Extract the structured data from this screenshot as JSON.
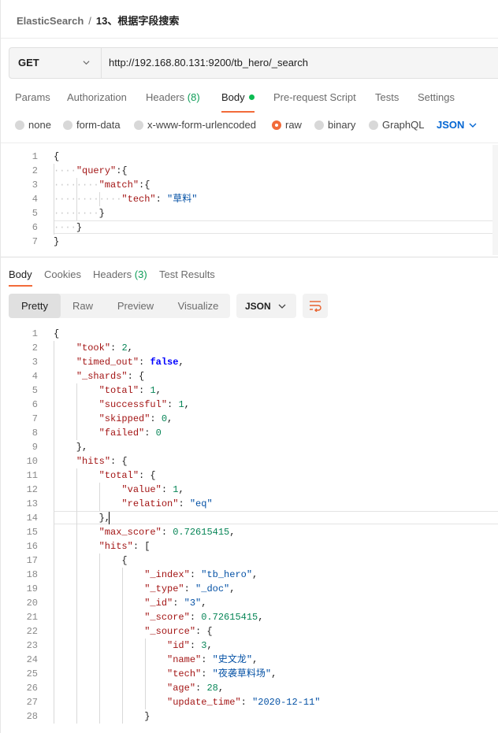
{
  "breadcrumb": {
    "parent": "ElasticSearch",
    "separator": "/",
    "current": "13、根据字段搜索"
  },
  "request": {
    "method": "GET",
    "url": "http://192.168.80.131:9200/tb_hero/_search",
    "tabs": [
      {
        "label": "Params"
      },
      {
        "label": "Authorization"
      },
      {
        "label": "Headers",
        "count": "(8)"
      },
      {
        "label": "Body",
        "active": true
      },
      {
        "label": "Pre-request Script"
      },
      {
        "label": "Tests"
      },
      {
        "label": "Settings"
      }
    ],
    "body_types": [
      "none",
      "form-data",
      "x-www-form-urlencoded",
      "raw",
      "binary",
      "GraphQL"
    ],
    "body_type_selected": "raw",
    "language": "JSON"
  },
  "request_lines": [
    [
      "{"
    ],
    [
      "····",
      "k:\"query\"",
      ":{"
    ],
    [
      "········",
      "k:\"match\"",
      ":{"
    ],
    [
      "············",
      "k:\"tech\"",
      ": ",
      "s:\"草料\""
    ],
    [
      "········",
      "}"
    ],
    [
      "····",
      "}"
    ],
    [
      "}"
    ]
  ],
  "response": {
    "tabs": [
      {
        "label": "Body",
        "active": true
      },
      {
        "label": "Cookies"
      },
      {
        "label": "Headers",
        "count": "(3)"
      },
      {
        "label": "Test Results"
      }
    ],
    "views": [
      "Pretty",
      "Raw",
      "Preview",
      "Visualize"
    ],
    "format": "JSON"
  },
  "response_lines": [
    [
      "{"
    ],
    [
      "    ",
      "k:\"took\"",
      ": ",
      "n:2",
      ","
    ],
    [
      "    ",
      "k:\"timed_out\"",
      ": ",
      "b:false",
      ","
    ],
    [
      "    ",
      "k:\"_shards\"",
      ": {"
    ],
    [
      "        ",
      "k:\"total\"",
      ": ",
      "n:1",
      ","
    ],
    [
      "        ",
      "k:\"successful\"",
      ": ",
      "n:1",
      ","
    ],
    [
      "        ",
      "k:\"skipped\"",
      ": ",
      "n:0",
      ","
    ],
    [
      "        ",
      "k:\"failed\"",
      ": ",
      "n:0"
    ],
    [
      "    },"
    ],
    [
      "    ",
      "k:\"hits\"",
      ": {"
    ],
    [
      "        ",
      "k:\"total\"",
      ": {"
    ],
    [
      "            ",
      "k:\"value\"",
      ": ",
      "n:1",
      ","
    ],
    [
      "            ",
      "k:\"relation\"",
      ": ",
      "s:\"eq\""
    ],
    [
      "        },"
    ],
    [
      "        ",
      "k:\"max_score\"",
      ": ",
      "n:0.72615415",
      ","
    ],
    [
      "        ",
      "k:\"hits\"",
      ": ["
    ],
    [
      "            {"
    ],
    [
      "                ",
      "k:\"_index\"",
      ": ",
      "s:\"tb_hero\"",
      ","
    ],
    [
      "                ",
      "k:\"_type\"",
      ": ",
      "s:\"_doc\"",
      ","
    ],
    [
      "                ",
      "k:\"_id\"",
      ": ",
      "s:\"3\"",
      ","
    ],
    [
      "                ",
      "k:\"_score\"",
      ": ",
      "n:0.72615415",
      ","
    ],
    [
      "                ",
      "k:\"_source\"",
      ": {"
    ],
    [
      "                    ",
      "k:\"id\"",
      ": ",
      "n:3",
      ","
    ],
    [
      "                    ",
      "k:\"name\"",
      ": ",
      "s:\"史文龙\"",
      ","
    ],
    [
      "                    ",
      "k:\"tech\"",
      ": ",
      "s:\"夜袭草料场\"",
      ","
    ],
    [
      "                    ",
      "k:\"age\"",
      ": ",
      "n:28",
      ","
    ],
    [
      "                    ",
      "k:\"update_time\"",
      ": ",
      "s:\"2020-12-11\""
    ],
    [
      "                }"
    ]
  ]
}
